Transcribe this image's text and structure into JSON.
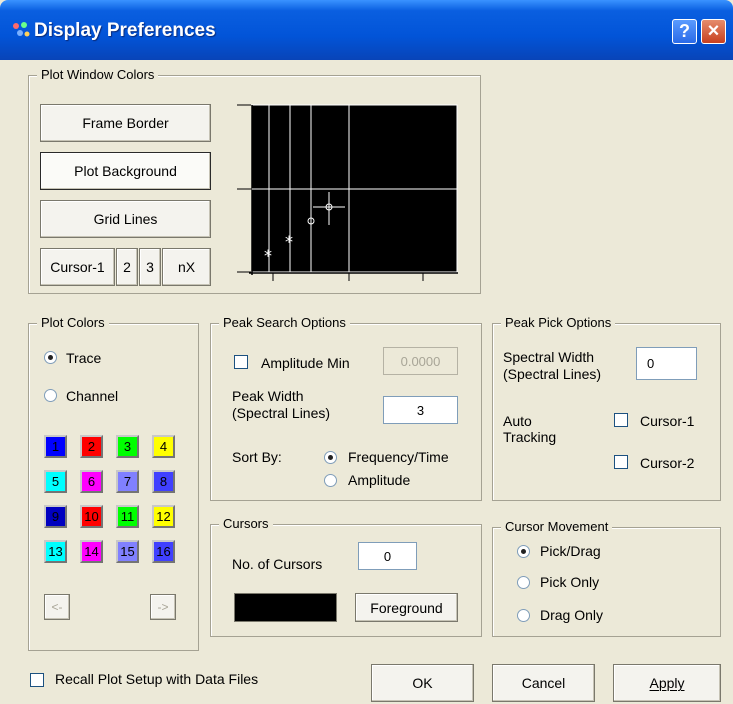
{
  "window": {
    "title": "Display Preferences",
    "help_label": "?",
    "close_label": "×"
  },
  "plot_window_colors": {
    "label": "Plot Window Colors",
    "frame_border": "Frame Border",
    "plot_background": "Plot Background",
    "grid_lines": "Grid Lines",
    "cursor1": "Cursor-1",
    "cursor2": "2",
    "cursor3": "3",
    "nx": "nX",
    "preview_background": "#000000",
    "preview_grid": "#ffffff"
  },
  "plot_colors": {
    "label": "Plot Colors",
    "trace": "Trace",
    "channel": "Channel",
    "selected": "Trace",
    "swatches": [
      {
        "n": "1",
        "color": "#0000ff"
      },
      {
        "n": "2",
        "color": "#ff0000"
      },
      {
        "n": "3",
        "color": "#00ff00"
      },
      {
        "n": "4",
        "color": "#ffff00"
      },
      {
        "n": "5",
        "color": "#00ffff"
      },
      {
        "n": "6",
        "color": "#ff00ff"
      },
      {
        "n": "7",
        "color": "#8080ff"
      },
      {
        "n": "8",
        "color": "#4040ff"
      },
      {
        "n": "9",
        "color": "#0000c0"
      },
      {
        "n": "10",
        "color": "#ff0000"
      },
      {
        "n": "11",
        "color": "#00ff00"
      },
      {
        "n": "12",
        "color": "#ffff00"
      },
      {
        "n": "13",
        "color": "#00ffff"
      },
      {
        "n": "14",
        "color": "#ff00ff"
      },
      {
        "n": "15",
        "color": "#8080ff"
      },
      {
        "n": "16",
        "color": "#4040ff"
      }
    ],
    "prev": "<-",
    "next": "->"
  },
  "peak_search": {
    "label": "Peak Search Options",
    "amplitude_min_label": "Amplitude Min",
    "amplitude_min_value": "0.0000",
    "peak_width_label1": "Peak Width",
    "peak_width_label2": "(Spectral Lines)",
    "peak_width_value": "3",
    "sort_by": "Sort By:",
    "freq_time": "Frequency/Time",
    "amplitude": "Amplitude",
    "selected": "Frequency/Time"
  },
  "peak_pick": {
    "label": "Peak Pick Options",
    "spectral_width_label1": "Spectral Width",
    "spectral_width_label2": "(Spectral Lines)",
    "spectral_width_value": "0",
    "auto_tracking1": "Auto",
    "auto_tracking2": "Tracking",
    "cursor1": "Cursor-1",
    "cursor2": "Cursor-2"
  },
  "cursors": {
    "label": "Cursors",
    "count_label": "No. of Cursors",
    "count_value": "0",
    "foreground": "Foreground",
    "color": "#000000"
  },
  "cursor_movement": {
    "label": "Cursor Movement",
    "pick_drag": "Pick/Drag",
    "pick_only": "Pick Only",
    "drag_only": "Drag Only",
    "selected": "Pick/Drag"
  },
  "footer": {
    "recall": "Recall Plot Setup with Data Files",
    "ok": "OK",
    "cancel": "Cancel",
    "apply": "Apply"
  }
}
